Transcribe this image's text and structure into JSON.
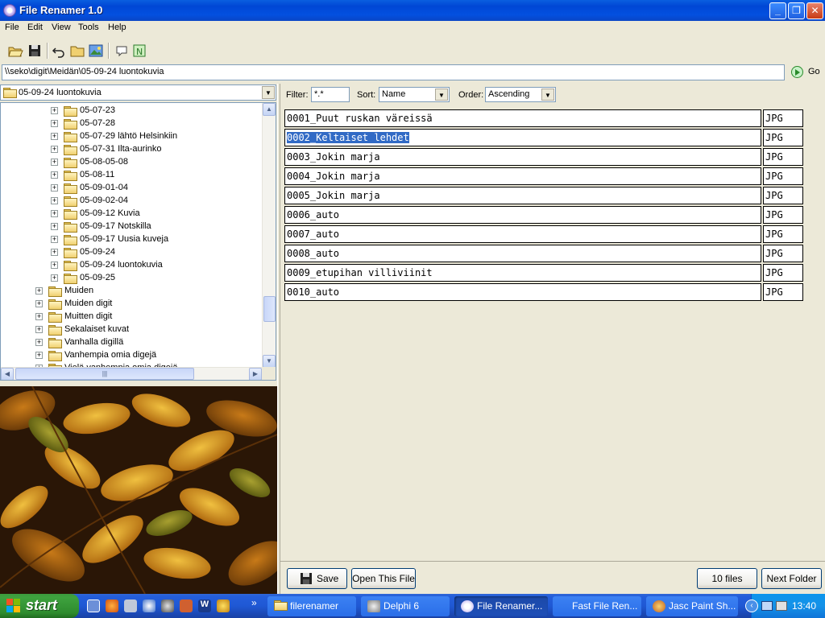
{
  "window": {
    "title": "File Renamer 1.0",
    "min_label": "_",
    "max_label": "❐",
    "close_label": "✕"
  },
  "menu": [
    "File",
    "Edit",
    "View",
    "Tools",
    "Help"
  ],
  "toolbar": {
    "icons": [
      "open-folder-icon",
      "save-icon",
      "undo-icon",
      "folder-icon",
      "image-icon",
      "comment-icon",
      "notepad-icon"
    ]
  },
  "address": {
    "path": "\\\\seko\\digit\\Meidän\\05-09-24 luontokuvia",
    "go_label": "Go"
  },
  "folder_combo": {
    "value": "05-09-24 luontokuvia"
  },
  "tree": {
    "items": [
      {
        "label": "05-07-23",
        "level": 2
      },
      {
        "label": "05-07-28",
        "level": 2
      },
      {
        "label": "05-07-29 lähtö Helsinkiin",
        "level": 2
      },
      {
        "label": "05-07-31 Ilta-aurinko",
        "level": 2
      },
      {
        "label": "05-08-05-08",
        "level": 2
      },
      {
        "label": "05-08-11",
        "level": 2
      },
      {
        "label": "05-09-01-04",
        "level": 2
      },
      {
        "label": "05-09-02-04",
        "level": 2
      },
      {
        "label": "05-09-12 Kuvia",
        "level": 2
      },
      {
        "label": "05-09-17 Notskilla",
        "level": 2
      },
      {
        "label": "05-09-17 Uusia kuveja",
        "level": 2
      },
      {
        "label": "05-09-24",
        "level": 2
      },
      {
        "label": "05-09-24 luontokuvia",
        "level": 2
      },
      {
        "label": "05-09-25",
        "level": 2
      },
      {
        "label": "Muiden",
        "level": 1
      },
      {
        "label": "Muiden digit",
        "level": 1
      },
      {
        "label": "Muitten digit",
        "level": 1
      },
      {
        "label": "Sekalaiset kuvat",
        "level": 1
      },
      {
        "label": "Vanhalla digillä",
        "level": 1
      },
      {
        "label": "Vanhempia omia digejä",
        "level": 1
      },
      {
        "label": "Vielä vanhempia omia digejä",
        "level": 1
      }
    ]
  },
  "filter": {
    "filter_label": "Filter:",
    "filter_value": "*.*",
    "sort_label": "Sort:",
    "sort_value": "Name",
    "order_label": "Order:",
    "order_value": "Ascending"
  },
  "files": [
    {
      "name": "0001_Puut ruskan väreissä",
      "ext": "JPG",
      "selected": false
    },
    {
      "name": "0002_Keltaiset lehdet",
      "ext": "JPG",
      "selected": true
    },
    {
      "name": "0003_Jokin marja",
      "ext": "JPG",
      "selected": false
    },
    {
      "name": "0004_Jokin marja",
      "ext": "JPG",
      "selected": false
    },
    {
      "name": "0005_Jokin marja",
      "ext": "JPG",
      "selected": false
    },
    {
      "name": "0006_auto",
      "ext": "JPG",
      "selected": false
    },
    {
      "name": "0007_auto",
      "ext": "JPG",
      "selected": false
    },
    {
      "name": "0008_auto",
      "ext": "JPG",
      "selected": false
    },
    {
      "name": "0009_etupihan villiviinit",
      "ext": "JPG",
      "selected": false
    },
    {
      "name": "0010_auto",
      "ext": "JPG",
      "selected": false
    }
  ],
  "bottom": {
    "save_label": "Save",
    "open_label": "Open This File",
    "count_label": "10 files",
    "next_label": "Next Folder"
  },
  "taskbar": {
    "start_label": "start",
    "overflow_label": "»",
    "tasks": [
      {
        "label": "filerenamer",
        "active": false
      },
      {
        "label": "Delphi 6",
        "active": false
      },
      {
        "label": "File Renamer...",
        "active": true
      },
      {
        "label": "Fast File Ren...",
        "active": false
      },
      {
        "label": "Jasc Paint Sh...",
        "active": false
      }
    ],
    "clock": "13:40"
  },
  "colors": {
    "selection": "#316ac5",
    "window_bg": "#ece9d8",
    "title_blue": "#0046d5"
  }
}
